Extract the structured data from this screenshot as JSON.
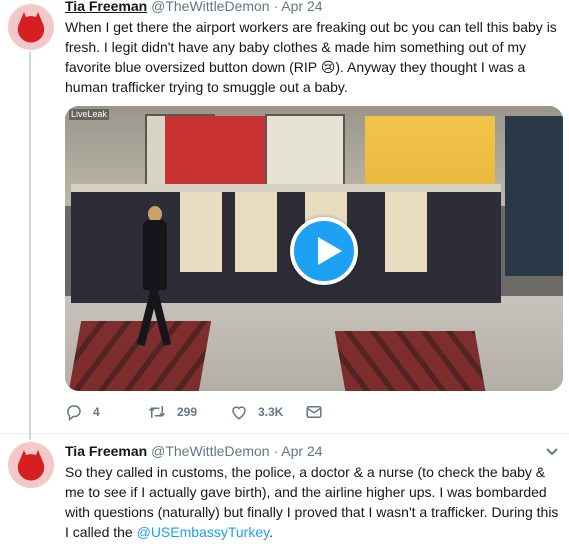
{
  "tweet1": {
    "author_name": "Tia Freeman",
    "author_handle": "@TheWittleDemon",
    "separator": "·",
    "date": "Apr 24",
    "text": "When I get there the airport workers are freaking out bc you can tell this baby is fresh. I legit didn't have any baby clothes & made him something out of my favorite blue oversized button down (RIP 😢). Anyway they thought I was a human trafficker trying to smuggle out a baby.",
    "media": {
      "watermark": "LiveLeak"
    },
    "actions": {
      "replies": "4",
      "retweets": "299",
      "likes": "3.3K"
    }
  },
  "tweet2": {
    "author_name": "Tia Freeman",
    "author_handle": "@TheWittleDemon",
    "separator": "·",
    "date": "Apr 24",
    "text_before_mention": "So they called in customs, the police, a doctor & a nurse (to check the baby & me to see if I actually gave birth), and the airline higher ups. I was bombarded with questions (naturally) but finally I proved that I wasn't a trafficker. During this I called the ",
    "mention": "@USEmbassyTurkey",
    "text_after_mention": "."
  },
  "icons": {
    "reply": "reply-icon",
    "retweet": "retweet-icon",
    "like": "heart-icon",
    "message": "envelope-icon",
    "caret": "chevron-down-icon",
    "play": "play-icon"
  },
  "colors": {
    "accent": "#1da1f2",
    "muted": "#657786",
    "text": "#14171a"
  }
}
